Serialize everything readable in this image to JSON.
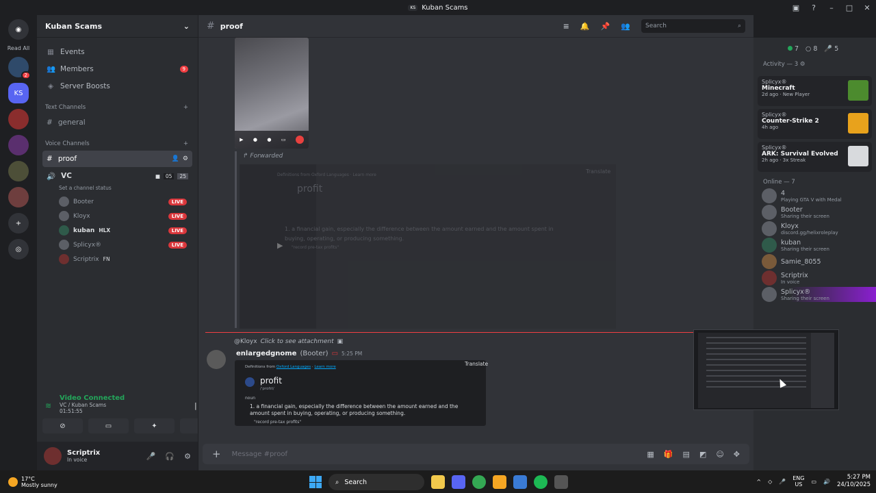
{
  "window": {
    "title": "Kuban Scams",
    "badge": "KS"
  },
  "guilds": {
    "read_all": "Read All",
    "items": [
      {
        "label": "",
        "badge": "2"
      },
      {
        "label": "KS",
        "badge": ""
      }
    ]
  },
  "sidebar": {
    "server_name": "Kuban Scams",
    "nav": [
      {
        "label": "Events",
        "count": ""
      },
      {
        "label": "Members",
        "count": "9"
      },
      {
        "label": "Server Boosts",
        "count": ""
      }
    ],
    "text_category": "Text Channels",
    "text_channels": [
      {
        "label": "general"
      }
    ],
    "voice_category": "Voice Channels",
    "selected_channel": "proof",
    "vc": {
      "label": "VC",
      "counts": [
        "05",
        "25"
      ],
      "status_hint": "Set a channel status",
      "users": [
        {
          "name": "Booter",
          "tag": "",
          "live": "LIVE"
        },
        {
          "name": "Kloyx",
          "tag": "",
          "live": "LIVE"
        },
        {
          "name": "kuban",
          "tag": "HLX",
          "live": "LIVE"
        },
        {
          "name": "Splicyx®",
          "tag": "",
          "live": "LIVE"
        },
        {
          "name": "Scriptrix",
          "tag": "FN",
          "live": ""
        }
      ]
    }
  },
  "voice_panel": {
    "status": "Video Connected",
    "location": "VC / Kuban Scams",
    "timer": "01:51:55"
  },
  "user_panel": {
    "name": "Scriptrix",
    "status": "In voice"
  },
  "channel_header": {
    "name": "proof",
    "search_placeholder": "Search"
  },
  "messages": {
    "forwarded_label": "Forwarded",
    "forwarded_embed": {
      "source": "Definitions from Oxford Languages · Learn more",
      "translate": "Translate",
      "word": "profit",
      "definition": "1. a financial gain, especially the difference between the amount earned and the amount spent in buying, operating, or producing something.",
      "example": "\"record pre-tax profits\""
    },
    "reply": {
      "mention": "@Kloyx",
      "hint": "Click to see attachment"
    },
    "author": "enlargedgnome",
    "author_role": "(Booter)",
    "time": "5:25 PM",
    "embed": {
      "source_prefix": "Definitions from",
      "source_link": "Oxford Languages",
      "learn_more": "Learn more",
      "translate": "Translate",
      "word": "profit",
      "pronunciation": "/ˈprɒfɪt/",
      "part_of_speech": "noun",
      "definition": "1. a financial gain, especially the difference between the amount earned and the amount spent in buying, operating, or producing something.",
      "example": "\"record pre-tax profits\""
    }
  },
  "composer": {
    "placeholder": "Message #proof"
  },
  "members_panel": {
    "stats": [
      "7",
      "8",
      "5"
    ],
    "activity_header": "Activity — 3",
    "activities": [
      {
        "user": "Splicyx®",
        "game": "Minecraft",
        "meta": "2d ago · New Player",
        "color": "#4c8b2e"
      },
      {
        "user": "Splicyx®",
        "game": "Counter-Strike 2",
        "meta": "4h ago",
        "color": "#e8a21c"
      },
      {
        "user": "Splicyx®",
        "game": "ARK: Survival Evolved",
        "meta": "2h ago · 3x Streak",
        "color": "#d8dadd"
      }
    ],
    "online_header": "Online — 7",
    "online": [
      {
        "name": "4",
        "status": "Playing GTA V with Medal"
      },
      {
        "name": "Booter",
        "status": "Sharing their screen"
      },
      {
        "name": "Kloyx",
        "status": "discord.gg/helixroleplay"
      },
      {
        "name": "kuban",
        "status": "Sharing their screen"
      },
      {
        "name": "Samie_8055",
        "status": ""
      },
      {
        "name": "Scriptrix",
        "status": "In voice"
      },
      {
        "name": "Splicyx®",
        "status": "Sharing their screen"
      }
    ]
  },
  "taskbar": {
    "temp": "17°C",
    "weather": "Mostly sunny",
    "search": "Search",
    "lang1": "ENG",
    "lang2": "US",
    "time": "5:27 PM",
    "date": "24/10/2025"
  },
  "colors": {
    "accent": "#5865f2",
    "live": "#da373c",
    "online": "#23a55a",
    "bg": "#313338"
  }
}
